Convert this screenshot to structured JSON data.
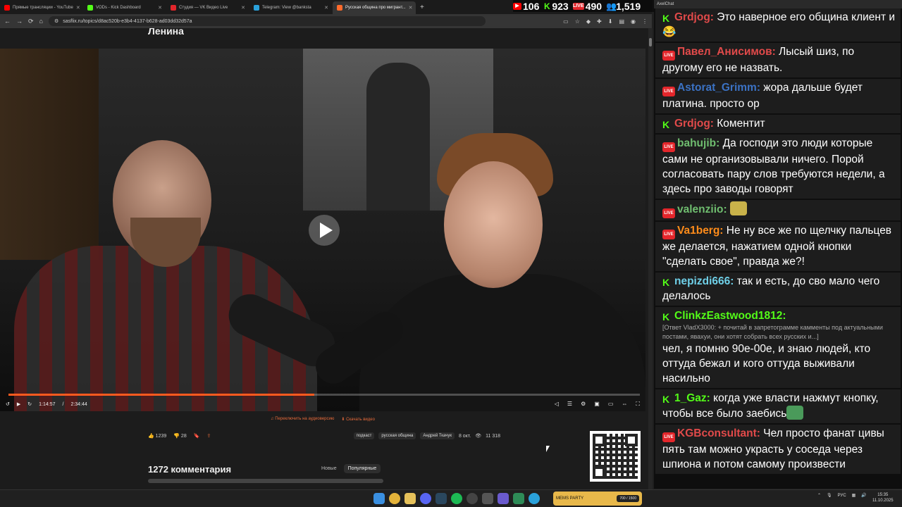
{
  "browser": {
    "tabs": [
      {
        "label": "Прямые трансляции - YouTube",
        "color": "#ff0000"
      },
      {
        "label": "VODs - Kick Dashboard",
        "color": "#53fc18"
      },
      {
        "label": "Студия — VK Видео Live",
        "color": "#e3262b"
      },
      {
        "label": "Telegram: View @banksta",
        "color": "#2aa1da"
      },
      {
        "label": "Русская община про мигрант...",
        "color": "#ff6a2b"
      }
    ],
    "url": "sasflix.ru/topics/d8ac520b-e3b4-4137-b628-ad03dd32d57a",
    "new_tab": "+"
  },
  "stream_stats": {
    "youtube": "106",
    "kick": "923",
    "vk": "490",
    "viewers": "1,519"
  },
  "page": {
    "title": "Ленина",
    "video": {
      "current_time": "1:14:57",
      "separator": "/",
      "duration": "2:34:44",
      "progress_fraction": 0.484
    },
    "audio_link": "Переключить на аудиоверсию",
    "download_link": "Скачать видео",
    "likes": "1239",
    "dislikes": "28",
    "tags": [
      "подкаст",
      "русская община",
      "Андрей Ткачук"
    ],
    "date": "8 окт.",
    "views": "11 318",
    "comments_title": "1272 комментария",
    "sort_new": "Новые",
    "sort_popular": "Популярные"
  },
  "chat": {
    "header": "AxelChat",
    "messages": [
      {
        "platform": "kick",
        "nick": "Grdjog:",
        "color": "#e14a4a",
        "text": " Это наверное его община клиент и 😂"
      },
      {
        "platform": "live",
        "nick": "Павел_Анисимов:",
        "color": "#e14a4a",
        "text": " Лысый шиз, по другому его не назвать."
      },
      {
        "platform": "live",
        "nick": "Astorat_Grimm:",
        "color": "#3b72c4",
        "text": " жора дальше будет платина. просто ор"
      },
      {
        "platform": "kick",
        "nick": "Grdjog:",
        "color": "#e14a4a",
        "text": " Коментит"
      },
      {
        "platform": "live",
        "nick": "bahujib:",
        "color": "#6fbd6f",
        "text": " Да господи это люди которые сами не организовывали ничего. Порой согласовать пару слов требуются недели, а здесь про заводы говорят"
      },
      {
        "platform": "live",
        "nick": "valenziio:",
        "color": "#6fbd6f",
        "text": " "
      },
      {
        "platform": "live",
        "nick": "Va1berg:",
        "color": "#ff8c1a",
        "text": " Не ну все же по щелчку пальцев же делается, нажатием одной кнопки \"сделать свое\", правда же?!"
      },
      {
        "platform": "kick",
        "nick": "nepizdi666:",
        "color": "#6fd0e8",
        "text": " так и есть, до сво мало чего делалось"
      },
      {
        "platform": "kick",
        "nick": "ClinkzEastwood1812:",
        "color": "#53fc18",
        "reply": "[Ответ VladX3000: + почитай в запретограмме камменты под актуальными постами, явахуи, они хотят собрать всех русских и...]",
        "text": "чел, я помню 90е-00е, и знаю людей, кто оттуда бежал и кого оттуда выживали насильно"
      },
      {
        "platform": "kick",
        "nick": "1_Gaz:",
        "color": "#53fc18",
        "text": " когда уже власти нажмут кнопку, чтобы все было заебись"
      },
      {
        "platform": "live",
        "nick": "KGBconsultant:",
        "color": "#e14a4a",
        "text": " Чел просто фанат цивы пять там можно украсть у соседа через шпиона и потом самому произвести"
      }
    ],
    "live_badge": "LIVE",
    "kick_badge": "K"
  },
  "taskbar": {
    "widget_label": "MEMS PARTY",
    "widget_count": "700 / 1500",
    "lang": "РУС",
    "time": "15:35",
    "date": "11.10.2025"
  },
  "colors": {
    "accent": "#ff5a1f",
    "kick": "#53fc18",
    "live": "#e3262b"
  }
}
